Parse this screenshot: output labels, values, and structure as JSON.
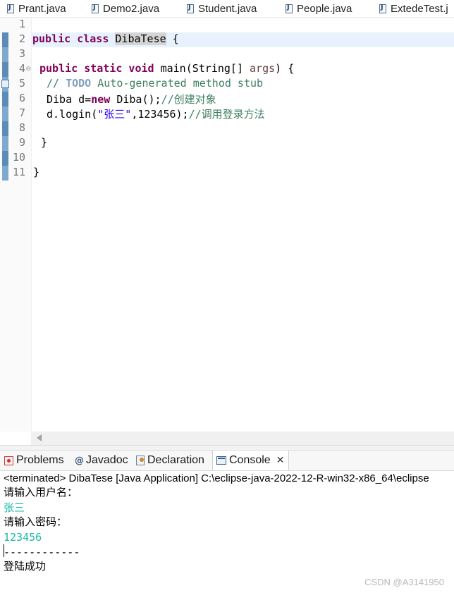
{
  "editor_tabs": [
    "Prant.java",
    "Demo2.java",
    "Student.java",
    "People.java",
    "ExtedeTest.j"
  ],
  "line_numbers": [
    "1",
    "2",
    "3",
    "4",
    "5",
    "6",
    "7",
    "8",
    "9",
    "10",
    "11"
  ],
  "code": {
    "l2_kw": "public class ",
    "l2_class": "DibaTese",
    "l2_rest": " {",
    "l4_kw": "public static void ",
    "l4_main": "main(String[] ",
    "l4_param": "args",
    "l4_rest": ") {",
    "l5_comment_start": "// ",
    "l5_todo": "TODO",
    "l5_comment_rest": " Auto-generated method stub",
    "l6_a": "Diba d=",
    "l6_kw": "new",
    "l6_b": " Diba();",
    "l6_comment": "//创建对象",
    "l7_a": "d.login(",
    "l7_str": "\"张三\"",
    "l7_b": ",123456);",
    "l7_comment": "//调用登录方法",
    "l9": "}",
    "l11": "}"
  },
  "console_tabs": {
    "problems": "Problems",
    "javadoc": "Javadoc",
    "declaration": "Declaration",
    "console": "Console",
    "close": "✕"
  },
  "console": {
    "terminated": "<terminated> DibaTese [Java Application] C:\\eclipse-java-2022-12-R-win32-x86_64\\eclipse",
    "line1": "请输入用户名：",
    "line2": "张三",
    "line3": "请输入密码：",
    "line4": "123456",
    "line5": "------------",
    "line6": "登陆成功"
  },
  "watermark": "CSDN @A3141950",
  "colors": {
    "keyword": "#7f0055",
    "comment": "#3f7f5f",
    "string": "#2a00ff",
    "console_input": "#1fb7a6",
    "current_line": "#e8f2fe"
  }
}
